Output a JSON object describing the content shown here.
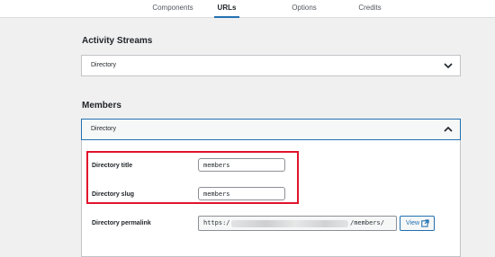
{
  "tabs": [
    {
      "label": "Components"
    },
    {
      "label": "URLs",
      "active": true
    },
    {
      "label": "Options"
    },
    {
      "label": "Credits"
    }
  ],
  "activity_streams": {
    "title": "Activity Streams",
    "accordion_label": "Directory"
  },
  "members": {
    "title": "Members",
    "accordion_label": "Directory",
    "fields": {
      "directory_title": {
        "label": "Directory title",
        "value": "members"
      },
      "directory_slug": {
        "label": "Directory slug",
        "value": "members"
      },
      "directory_permalink": {
        "label": "Directory permalink",
        "prefix": "https:/",
        "suffix": "/members/"
      }
    },
    "view_button": "View"
  },
  "colors": {
    "accent": "#2271b1",
    "highlight": "#e0142c",
    "background": "#f0f0f1"
  }
}
